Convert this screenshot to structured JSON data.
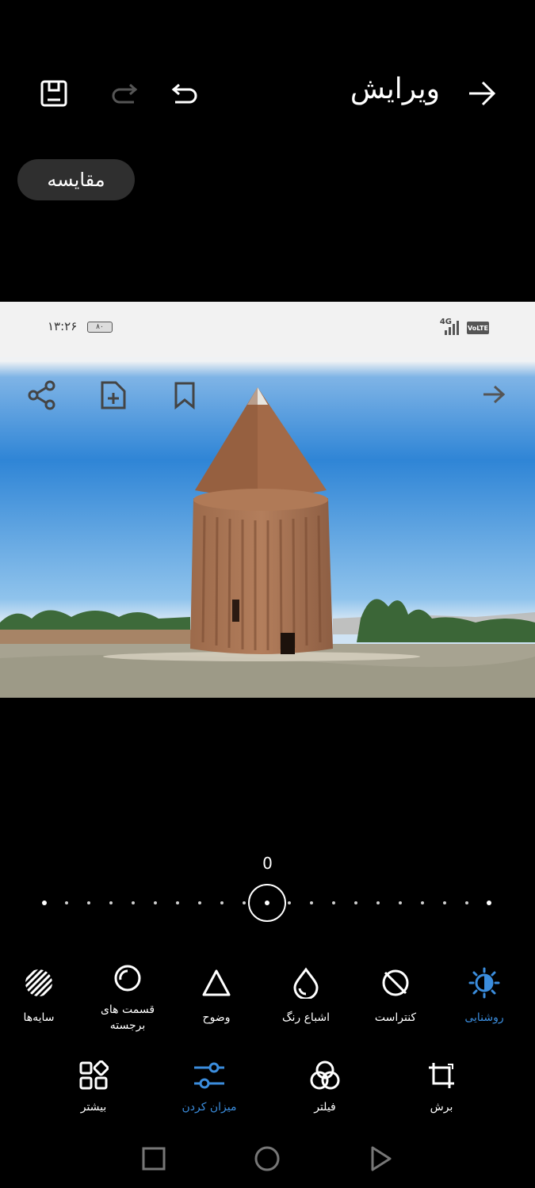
{
  "header": {
    "title": "ویرایش",
    "compare_label": "مقایسه",
    "back_icon": "arrow-right-icon",
    "undo_icon": "undo-icon",
    "redo_icon": "redo-icon",
    "save_icon": "save-icon"
  },
  "photo": {
    "status_time": "۱۳:۲۶",
    "battery": "۸۰",
    "network": "4G",
    "volte": "VoLTE"
  },
  "slider": {
    "value": "0",
    "level": 0.5
  },
  "tools": [
    {
      "label": "روشنایی",
      "icon": "brightness-icon",
      "active": true
    },
    {
      "label": "کنتراست",
      "icon": "contrast-icon",
      "active": false
    },
    {
      "label": "اشباع رنگ",
      "icon": "saturation-drop-icon",
      "active": false
    },
    {
      "label": "وضوح",
      "icon": "sharpness-triangle-icon",
      "active": false
    },
    {
      "label": "قسمت های برجسته",
      "icon": "highlights-circle-icon",
      "active": false
    },
    {
      "label": "سایه‌ها",
      "icon": "shadows-stripes-icon",
      "active": false
    }
  ],
  "tabs": [
    {
      "label": "برش",
      "icon": "crop-icon",
      "active": false
    },
    {
      "label": "فیلتر",
      "icon": "filter-icon",
      "active": false
    },
    {
      "label": "میزان کردن",
      "icon": "adjust-sliders-icon",
      "active": true
    },
    {
      "label": "بیشتر",
      "icon": "more-grid-icon",
      "active": false
    }
  ],
  "colors": {
    "accent": "#3b8ddd",
    "background": "#000000",
    "pill": "#2f2f2f"
  }
}
